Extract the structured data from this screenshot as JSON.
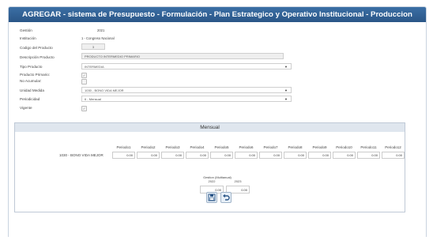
{
  "window": {
    "title": "AGREGAR - sistema de Presupuesto - Formulación - Plan Estrategico y Operativo Institucional - Produccion"
  },
  "form": {
    "gestion": {
      "label": "Gestión",
      "value": "2021"
    },
    "institucion": {
      "label": "Institución",
      "value": "1 - Congreso Nacional"
    },
    "codigo": {
      "label": "Codigo del Producto",
      "value": "3"
    },
    "descripcion": {
      "label": "Descripción Producto",
      "value": "PRODUCTO INTERMEDIO PRIMARIO"
    },
    "tipo": {
      "label": "Tipo Producto",
      "value": "INTERMEDIA"
    },
    "primario": {
      "label": "Producto Primario:",
      "checked": true
    },
    "acumular": {
      "label": "No Acumular:",
      "checked": false
    },
    "unidad": {
      "label": "Unidad Medida",
      "value": "1030 - BONO VIDA MEJOR"
    },
    "periodicidad": {
      "label": "Periodicidad",
      "value": "6 - Mensual"
    },
    "vigente": {
      "label": "Vigente",
      "checked": true
    }
  },
  "mensual": {
    "title": "Mensual",
    "row_label": "1030 - BONO VIDA MEJOR",
    "periods": [
      {
        "label": "Periodo1",
        "value": "0.00"
      },
      {
        "label": "Periodo2",
        "value": "0.00"
      },
      {
        "label": "Periodo3",
        "value": "0.00"
      },
      {
        "label": "Periodo4",
        "value": "0.00"
      },
      {
        "label": "Periodo5",
        "value": "0.00"
      },
      {
        "label": "Periodo6",
        "value": "0.00"
      },
      {
        "label": "Periodo7",
        "value": "0.00"
      },
      {
        "label": "Periodo8",
        "value": "0.00"
      },
      {
        "label": "Periodo9",
        "value": "0.00"
      },
      {
        "label": "Periodo10",
        "value": "0.00"
      },
      {
        "label": "Periodo11",
        "value": "0.00"
      },
      {
        "label": "Periodo12",
        "value": "0.00"
      }
    ],
    "multianual": {
      "title": "Gestion (Multianual)",
      "years": [
        {
          "year": "2022",
          "value": "0.00"
        },
        {
          "year": "2023",
          "value": "0.00"
        }
      ]
    }
  },
  "buttons": {
    "save": "save-icon",
    "undo": "undo-icon"
  }
}
